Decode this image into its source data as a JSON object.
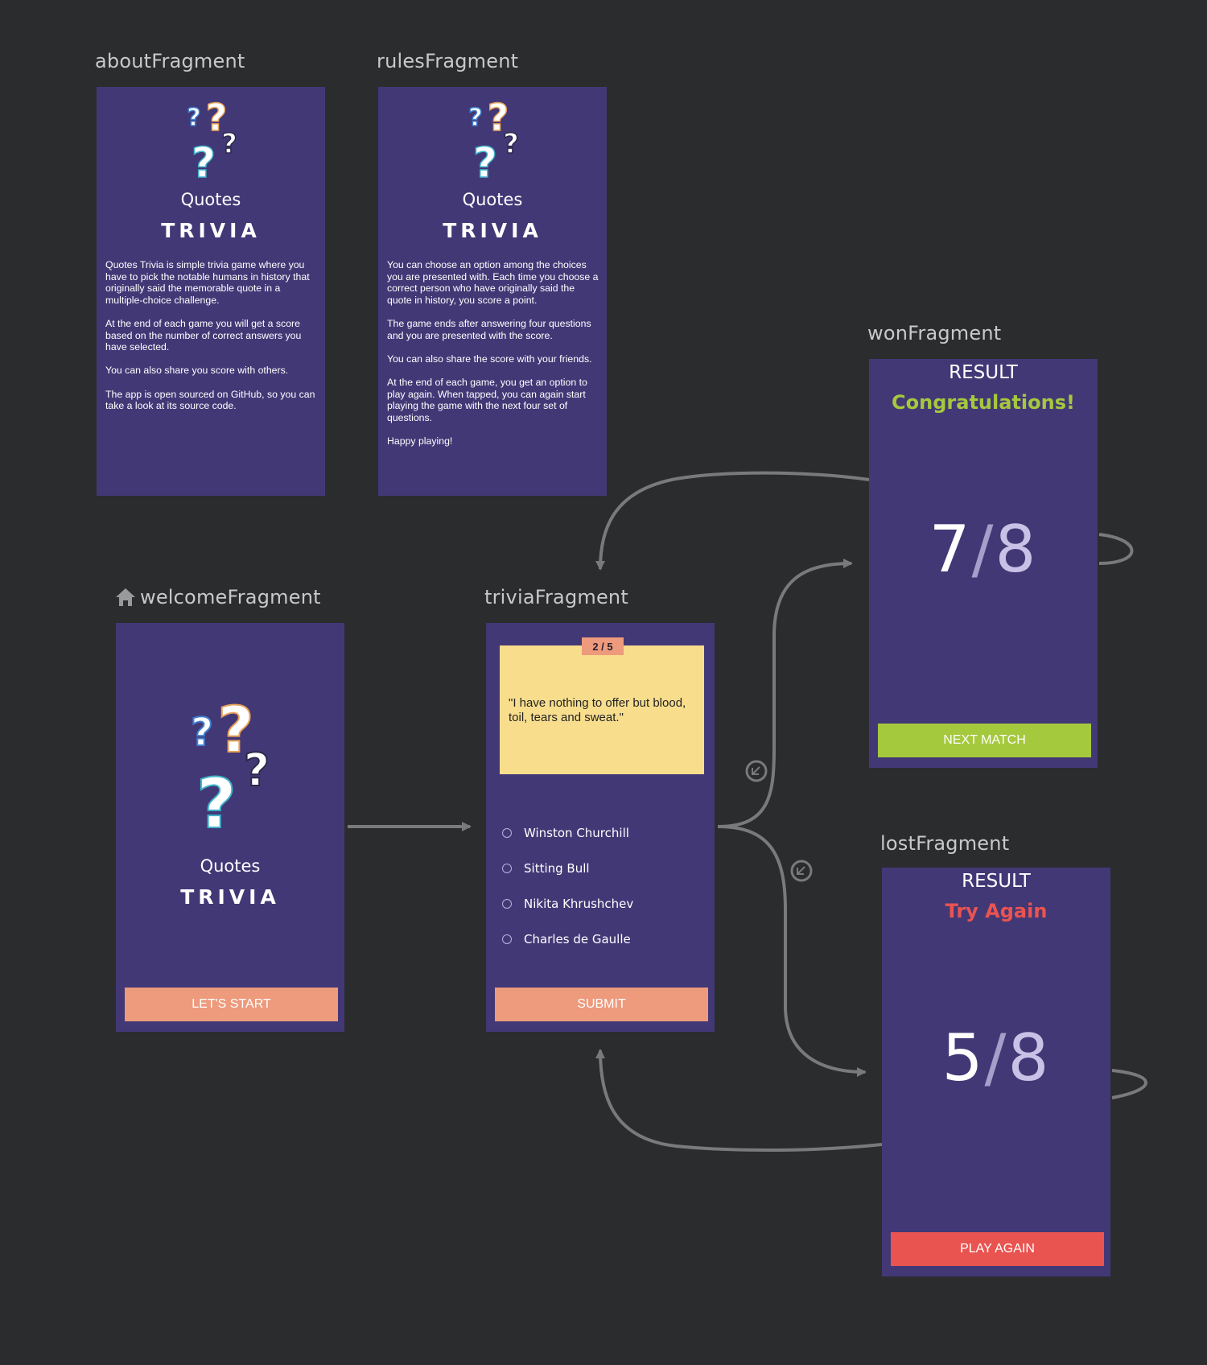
{
  "fragments": {
    "about": {
      "label": "aboutFragment",
      "app_quotes": "Quotes",
      "app_trivia": "TRIVIA",
      "paragraphs": [
        "Quotes Trivia is simple trivia game where you have to pick the notable humans in history that originally said the memorable quote in a multiple-choice challenge.",
        "At the end of each game you will get a score based on the number of correct answers you have selected.",
        "You can also share you score with others.",
        "The app is open sourced on GitHub, so you can take a look at its source code."
      ]
    },
    "rules": {
      "label": "rulesFragment",
      "app_quotes": "Quotes",
      "app_trivia": "TRIVIA",
      "paragraphs": [
        "You can choose an option among the choices you are presented with. Each time you choose a correct person who have originally said the quote in history, you score a point.",
        "The game ends after answering four questions and you are presented with the score.",
        "You can also share the score with your friends.",
        "At the end of each game, you get an option to play again. When tapped, you can again start playing the game with the next four set of questions.",
        "Happy playing!"
      ]
    },
    "welcome": {
      "label": "welcomeFragment",
      "app_quotes": "Quotes",
      "app_trivia": "TRIVIA",
      "button": "LET'S START"
    },
    "trivia": {
      "label": "triviaFragment",
      "progress": "2 / 5",
      "quote": "\"I have nothing to offer but blood, toil, tears and sweat.\"",
      "options": [
        "Winston Churchill",
        "Sitting Bull",
        "Nikita Khrushchev",
        "Charles de Gaulle"
      ],
      "button": "SUBMIT"
    },
    "won": {
      "label": "wonFragment",
      "title": "RESULT",
      "message": "Congratulations!",
      "score": "7",
      "slash": "/",
      "total": "8",
      "button": "NEXT MATCH"
    },
    "lost": {
      "label": "lostFragment",
      "title": "RESULT",
      "message": "Try Again",
      "score": "5",
      "slash": "/",
      "total": "8",
      "button": "PLAY AGAIN"
    }
  },
  "icons": {
    "start_destination": "home-icon",
    "action_badge": "action-icon",
    "logo": "question-marks-icon"
  },
  "colors": {
    "canvas": "#2b2c2e",
    "screen": "#433876",
    "primary_button": "#ee9a7c",
    "next_button": "#a5c93d",
    "play_again_button": "#ea5450",
    "congrats": "#a5c93d",
    "try_again": "#ea5450",
    "quote_card": "#f8dd8d",
    "progress_badge": "#ee9a7c",
    "arrow": "#7a7a7a"
  }
}
